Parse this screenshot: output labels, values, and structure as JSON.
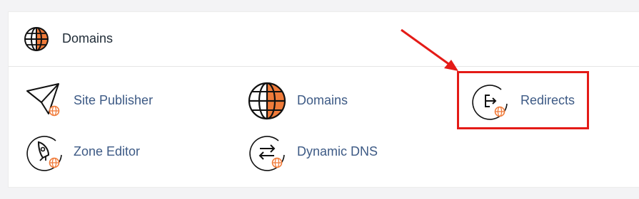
{
  "section": {
    "title": "Domains",
    "header_icon": "globe-icon"
  },
  "items": [
    {
      "label": "Site Publisher",
      "icon": "paper-plane-globe-icon"
    },
    {
      "label": "Domains",
      "icon": "globe-icon"
    },
    {
      "label": "Redirects",
      "icon": "redirect-globe-icon"
    },
    {
      "label": "Zone Editor",
      "icon": "rocket-globe-icon"
    },
    {
      "label": "Dynamic DNS",
      "icon": "swap-arrows-globe-icon"
    }
  ],
  "colors": {
    "accent_orange": "#f07b3a",
    "link_blue": "#3d5a85",
    "highlight_red": "#e41b17"
  }
}
